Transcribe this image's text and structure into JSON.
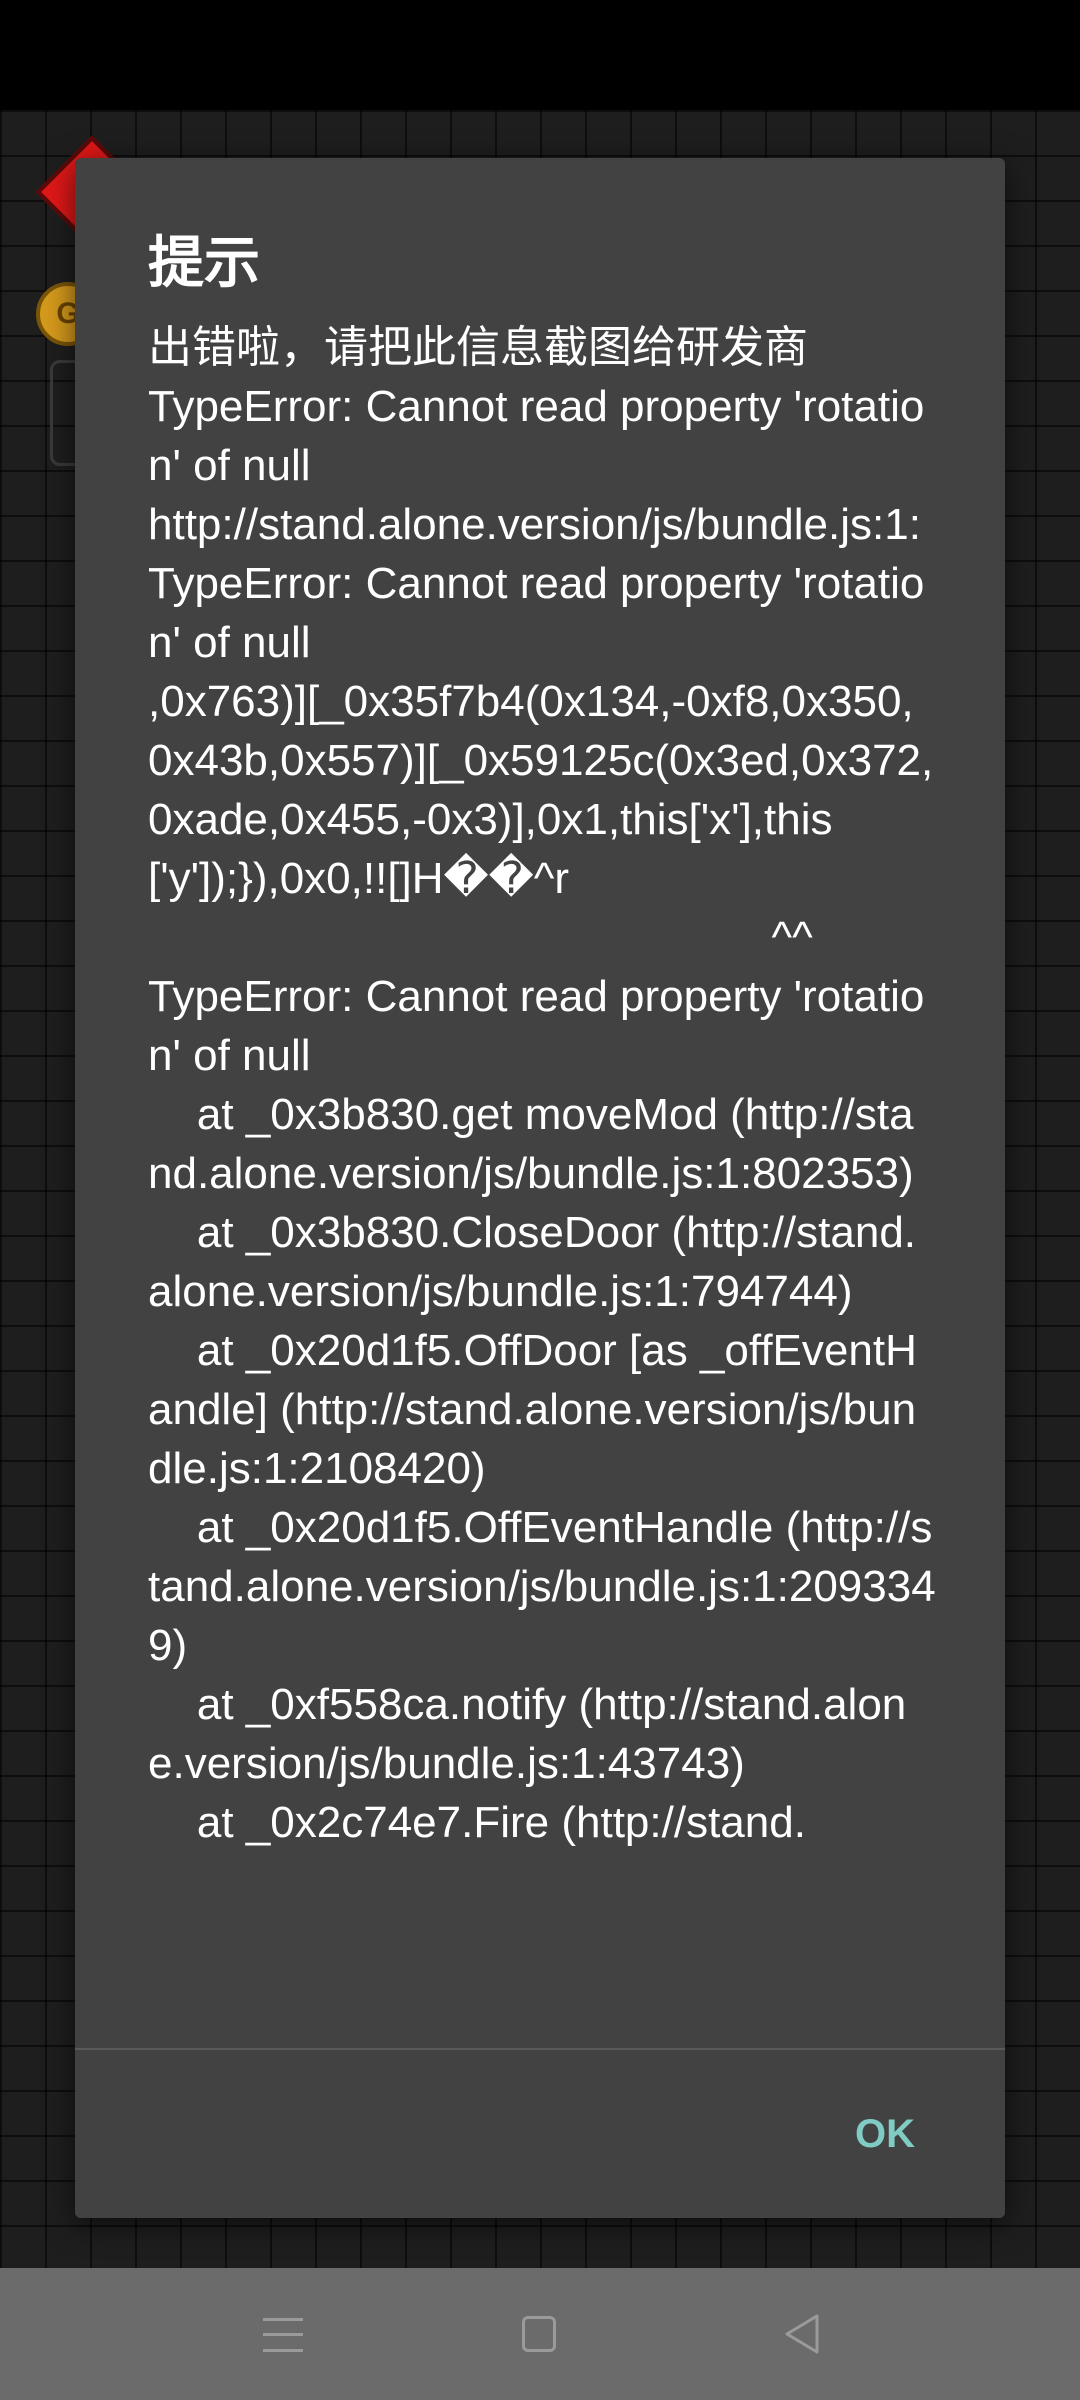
{
  "background": {
    "coin_letter": "G"
  },
  "dialog": {
    "title": "提示",
    "message": "出错啦，请把此信息截图给研发商\nTypeError: Cannot read property 'rotation' of null\nhttp://stand.alone.version/js/bundle.js:1:\nTypeError: Cannot read property 'rotation' of null\n,0x763)][_0x35f7b4(0x134,-0xf8,0x350,0x43b,0x557)][_0x59125c(0x3ed,0x372,0xade,0x455,-0x3)],0x1,this['x'],this['y']);}),0x0,!![]H��^r\n                                                   ^^\nTypeError: Cannot read property 'rotation' of null\n    at _0x3b830.get moveMod (http://stand.alone.version/js/bundle.js:1:802353)\n    at _0x3b830.CloseDoor (http://stand.alone.version/js/bundle.js:1:794744)\n    at _0x20d1f5.OffDoor [as _offEventHandle] (http://stand.alone.version/js/bundle.js:1:2108420)\n    at _0x20d1f5.OffEventHandle (http://stand.alone.version/js/bundle.js:1:2093349)\n    at _0xf558ca.notify (http://stand.alone.version/js/bundle.js:1:43743)\n    at _0x2c74e7.Fire (http://stand.",
    "ok_label": "OK"
  },
  "colors": {
    "dialog_bg": "#424242",
    "ok_accent": "#80cbc4",
    "nav_bar": "#6b6b6b"
  },
  "nav_bar": {
    "icons": [
      "menu-icon",
      "home-icon",
      "back-icon"
    ]
  }
}
